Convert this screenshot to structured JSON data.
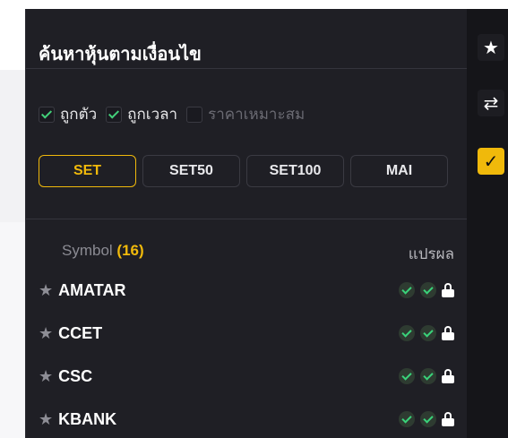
{
  "panel": {
    "title": "ค้นหาหุ้นตามเงื่อนไข",
    "filters": [
      {
        "label": "ถูกตัว",
        "checked": true
      },
      {
        "label": "ถูกเวลา",
        "checked": true
      },
      {
        "label": "ราคาเหมาะสม",
        "checked": false
      }
    ],
    "tabs": [
      {
        "label": "SET",
        "active": true
      },
      {
        "label": "SET50",
        "active": false
      },
      {
        "label": "SET100",
        "active": false
      },
      {
        "label": "MAI",
        "active": false
      }
    ],
    "list_header": {
      "symbol_label": "Symbol",
      "count_text": "(16)",
      "result_label": "แปรผล"
    },
    "rows": [
      {
        "symbol": "AMATAR"
      },
      {
        "symbol": "CCET"
      },
      {
        "symbol": "CSC"
      },
      {
        "symbol": "KBANK"
      }
    ]
  },
  "rail": {
    "buttons": [
      {
        "icon": "star-icon"
      },
      {
        "icon": "swap-arrows-icon"
      },
      {
        "icon": "magic-check-icon"
      }
    ]
  },
  "colors": {
    "accent": "#f0b90b",
    "panel_bg": "#1f1f25",
    "success": "#3ad37a"
  }
}
